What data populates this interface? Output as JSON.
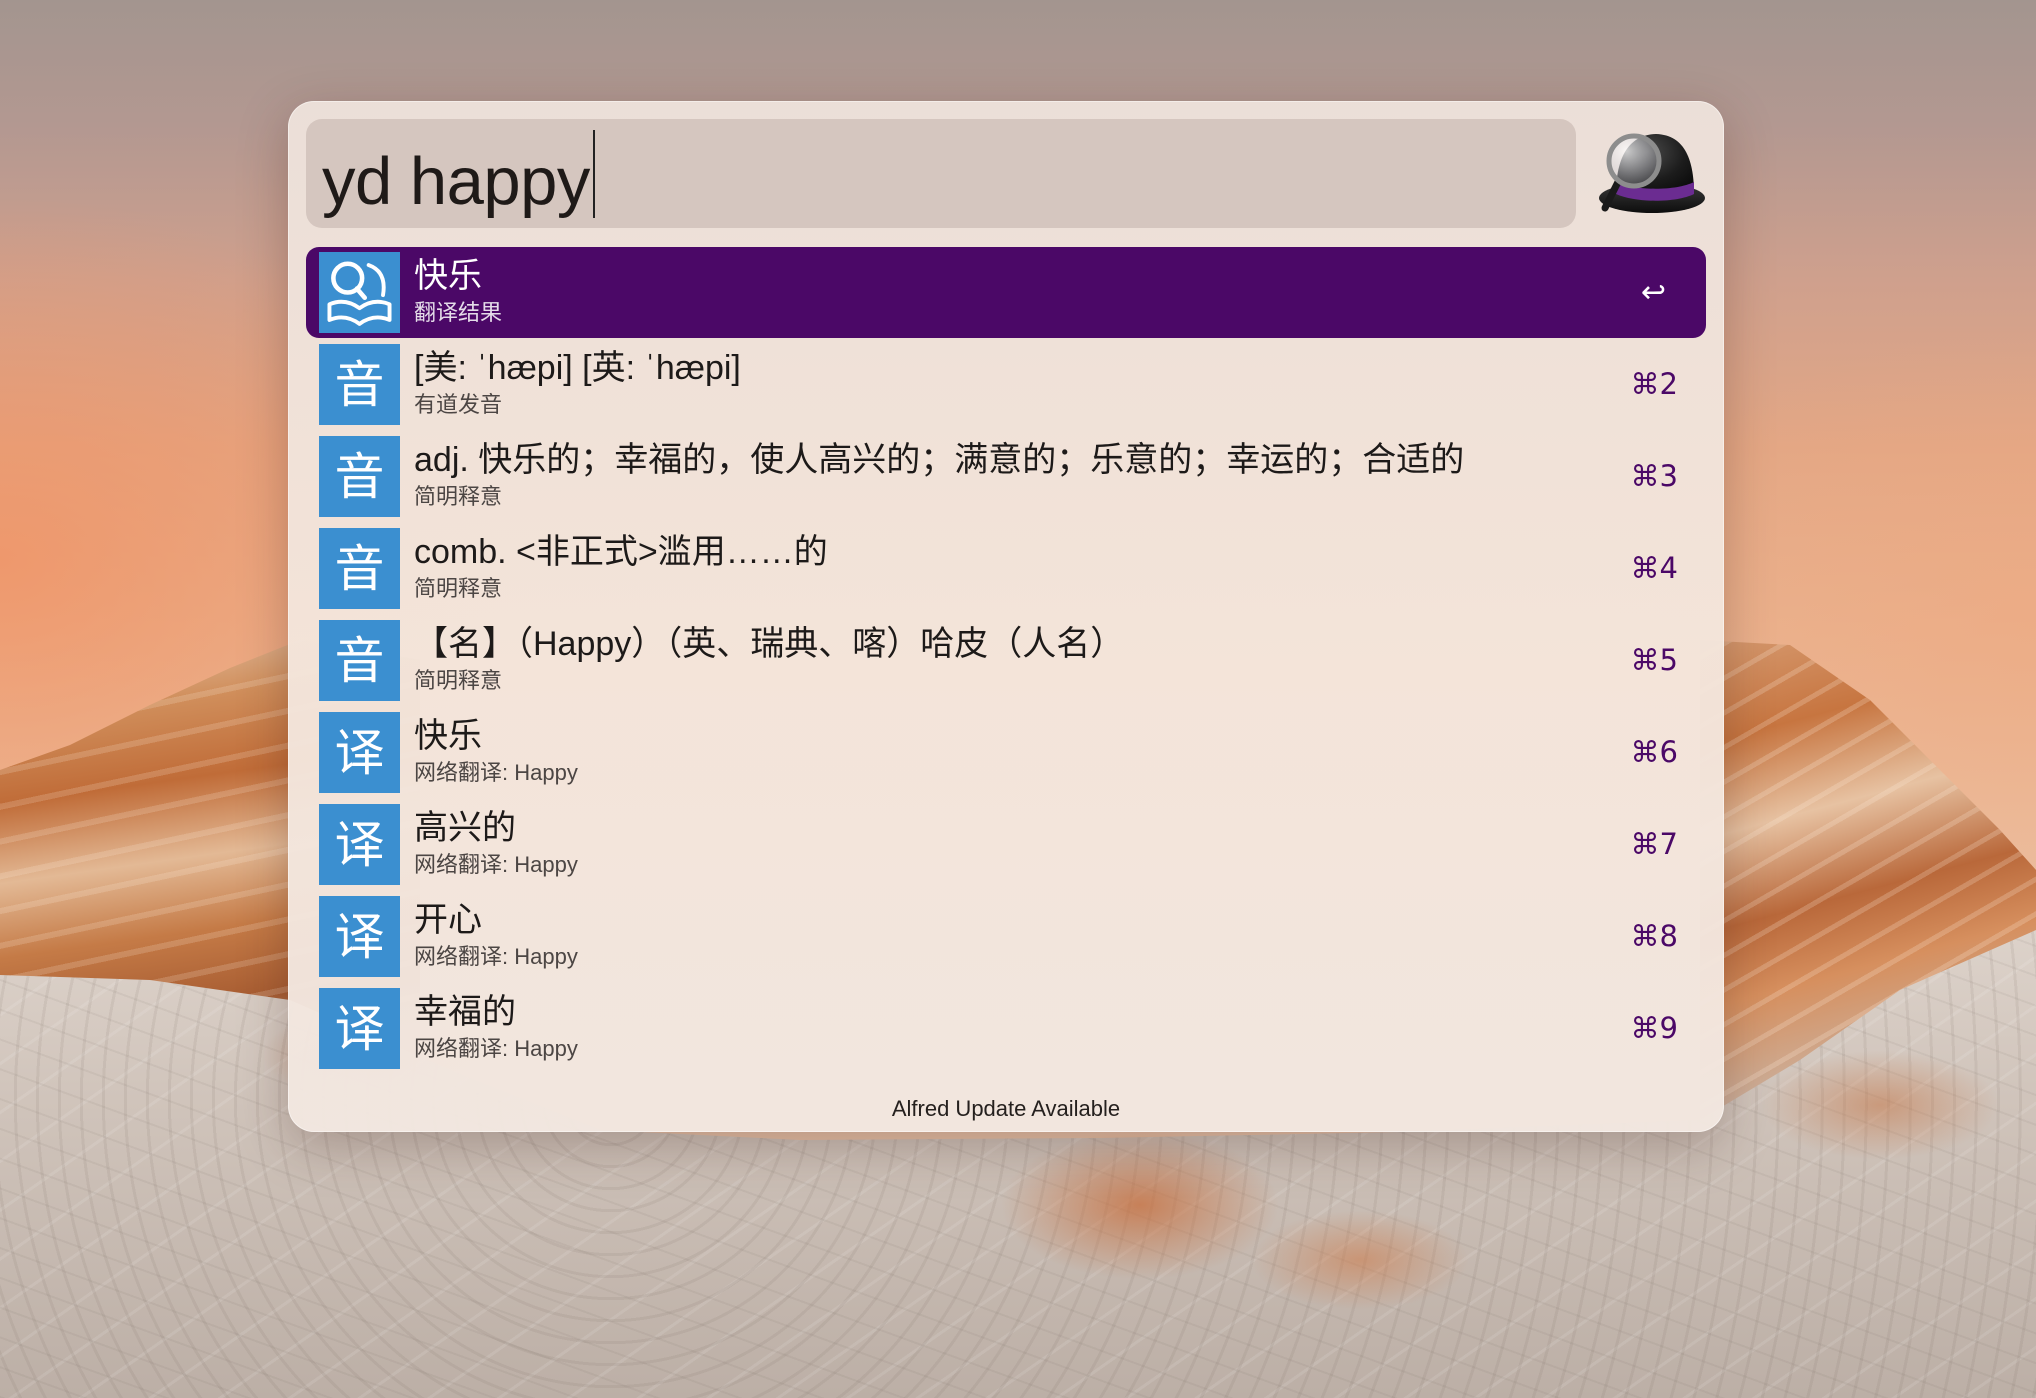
{
  "search": {
    "query": "yd happy"
  },
  "results": [
    {
      "title": "快乐",
      "subtitle": "翻译结果",
      "shortcut": "↩",
      "icon": "youdao-translate-icon",
      "selected": true
    },
    {
      "title": "[美: ˈhæpi] [英: ˈhæpi]",
      "subtitle": "有道发音",
      "shortcut": "⌘2",
      "icon": "sound-char-icon",
      "icon_label": "音"
    },
    {
      "title": "adj. 快乐的；幸福的，使人高兴的；满意的；乐意的；幸运的；合适的",
      "subtitle": "简明释意",
      "shortcut": "⌘3",
      "icon": "sound-char-icon",
      "icon_label": "音"
    },
    {
      "title": "comb. <非正式>滥用……的",
      "subtitle": "简明释意",
      "shortcut": "⌘4",
      "icon": "sound-char-icon",
      "icon_label": "音"
    },
    {
      "title": "【名】（Happy）（英、瑞典、喀）哈皮（人名）",
      "subtitle": "简明释意",
      "shortcut": "⌘5",
      "icon": "sound-char-icon",
      "icon_label": "音"
    },
    {
      "title": "快乐",
      "subtitle": "网络翻译: Happy",
      "shortcut": "⌘6",
      "icon": "translate-char-icon",
      "icon_label": "译"
    },
    {
      "title": "高兴的",
      "subtitle": "网络翻译: Happy",
      "shortcut": "⌘7",
      "icon": "translate-char-icon",
      "icon_label": "译"
    },
    {
      "title": "开心",
      "subtitle": "网络翻译: Happy",
      "shortcut": "⌘8",
      "icon": "translate-char-icon",
      "icon_label": "译"
    },
    {
      "title": "幸福的",
      "subtitle": "网络翻译: Happy",
      "shortcut": "⌘9",
      "icon": "translate-char-icon",
      "icon_label": "译"
    }
  ],
  "footer": {
    "text": "Alfred Update Available"
  },
  "colors": {
    "selection": "#4b0867",
    "shortcut": "#4b0867",
    "icon_blue": "#3b8fd0"
  }
}
